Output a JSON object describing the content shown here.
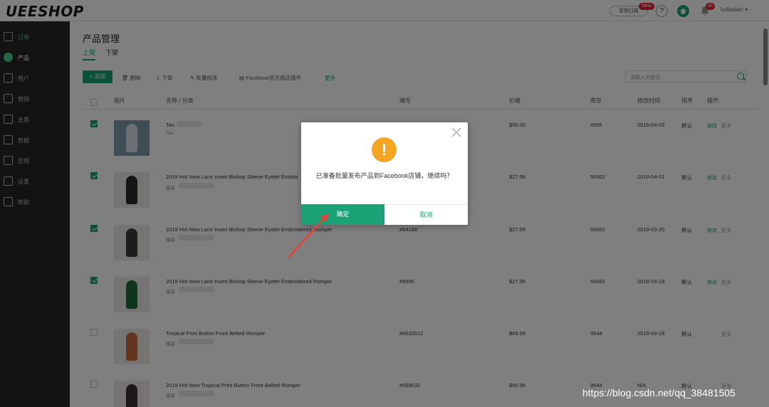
{
  "header": {
    "logo": "UEESHOP",
    "pill_button": "营销日报",
    "new_badge": "New",
    "help": "?",
    "bell_count": "99",
    "username": "lydiadakr"
  },
  "sidebar": {
    "items": [
      {
        "label": "订单",
        "icon": "orders-icon"
      },
      {
        "label": "产品",
        "icon": "products-icon"
      },
      {
        "label": "用户",
        "icon": "user-icon"
      },
      {
        "label": "营销",
        "icon": "marketing-icon"
      },
      {
        "label": "主题",
        "icon": "theme-icon"
      },
      {
        "label": "数据",
        "icon": "data-icon"
      },
      {
        "label": "应用",
        "icon": "apps-icon"
      },
      {
        "label": "设置",
        "icon": "settings-icon"
      },
      {
        "label": "帮助",
        "icon": "help-icon"
      }
    ]
  },
  "main": {
    "title": "产品管理",
    "tabs": [
      "上架",
      "下架"
    ],
    "toolbar": {
      "add": "+ 添加",
      "delete": "删除",
      "offline": "下架",
      "batch_edit": "批量修改",
      "facebook": "Facebook官方商店插件",
      "more": "更多"
    },
    "search_placeholder": "请输入关键词",
    "columns": [
      "图片",
      "名称 / 分类",
      "编号",
      "价格",
      "库存",
      "修改时间",
      "排序",
      "操作"
    ],
    "rows": [
      {
        "name": "Tao",
        "sub": "Tao",
        "code": "",
        "price": "$50.00",
        "stock": "4995",
        "date": "2019-04-03",
        "sort": "默认",
        "op1": "修改",
        "op2": "更多"
      },
      {
        "name": "2019 Hot New Lace Insert Bishop Sleeve Eyelet Embroi",
        "sub": "服装",
        "code": "",
        "price": "$27.99",
        "stock": "56062",
        "date": "2019-04-01",
        "sort": "默认",
        "op1": "修改",
        "op2": "更多"
      },
      {
        "name": "2019 Hot New Lace Insert Bishop Sleeve Eyelet Embroidered Romper",
        "sub": "服装",
        "code": "#64188",
        "price": "$27.99",
        "stock": "56062",
        "date": "2019-03-20",
        "sort": "默认",
        "op1": "修改",
        "op2": "更多"
      },
      {
        "name": "2019 Hot New Lace Insert Bishop Sleeve Eyelet Embroidered Romper",
        "sub": "服装",
        "code": "#9596",
        "price": "$27.99",
        "stock": "56062",
        "date": "2019-03-18",
        "sort": "默认",
        "op1": "修改",
        "op2": "更多"
      },
      {
        "name": "Tropical Print Button Front Belted Romper",
        "sub": "服装",
        "code": "#6632612",
        "price": "$69.99",
        "stock": "3544",
        "date": "2019-03-18",
        "sort": "默认",
        "op1": "",
        "op2": "更多"
      },
      {
        "name": "2019 Hot New Tropical Print Button Front Belted Romper",
        "sub": "服装",
        "code": "#659632",
        "price": "$66.99",
        "stock": "3544",
        "date": "N/A",
        "sort": "默认",
        "op1": "",
        "op2": "更多"
      }
    ]
  },
  "modal": {
    "message": "已准备批量发布产品到Facebook店铺，继续吗？",
    "ok": "确定",
    "cancel": "取消",
    "icon": "warning-icon"
  },
  "watermark": "https://blog.csdn.net/qq_38481505",
  "colors": {
    "accent": "#1aa175",
    "warning": "#f4a622",
    "sidebar_bg": "#262626",
    "arrow": "#e8403a"
  }
}
